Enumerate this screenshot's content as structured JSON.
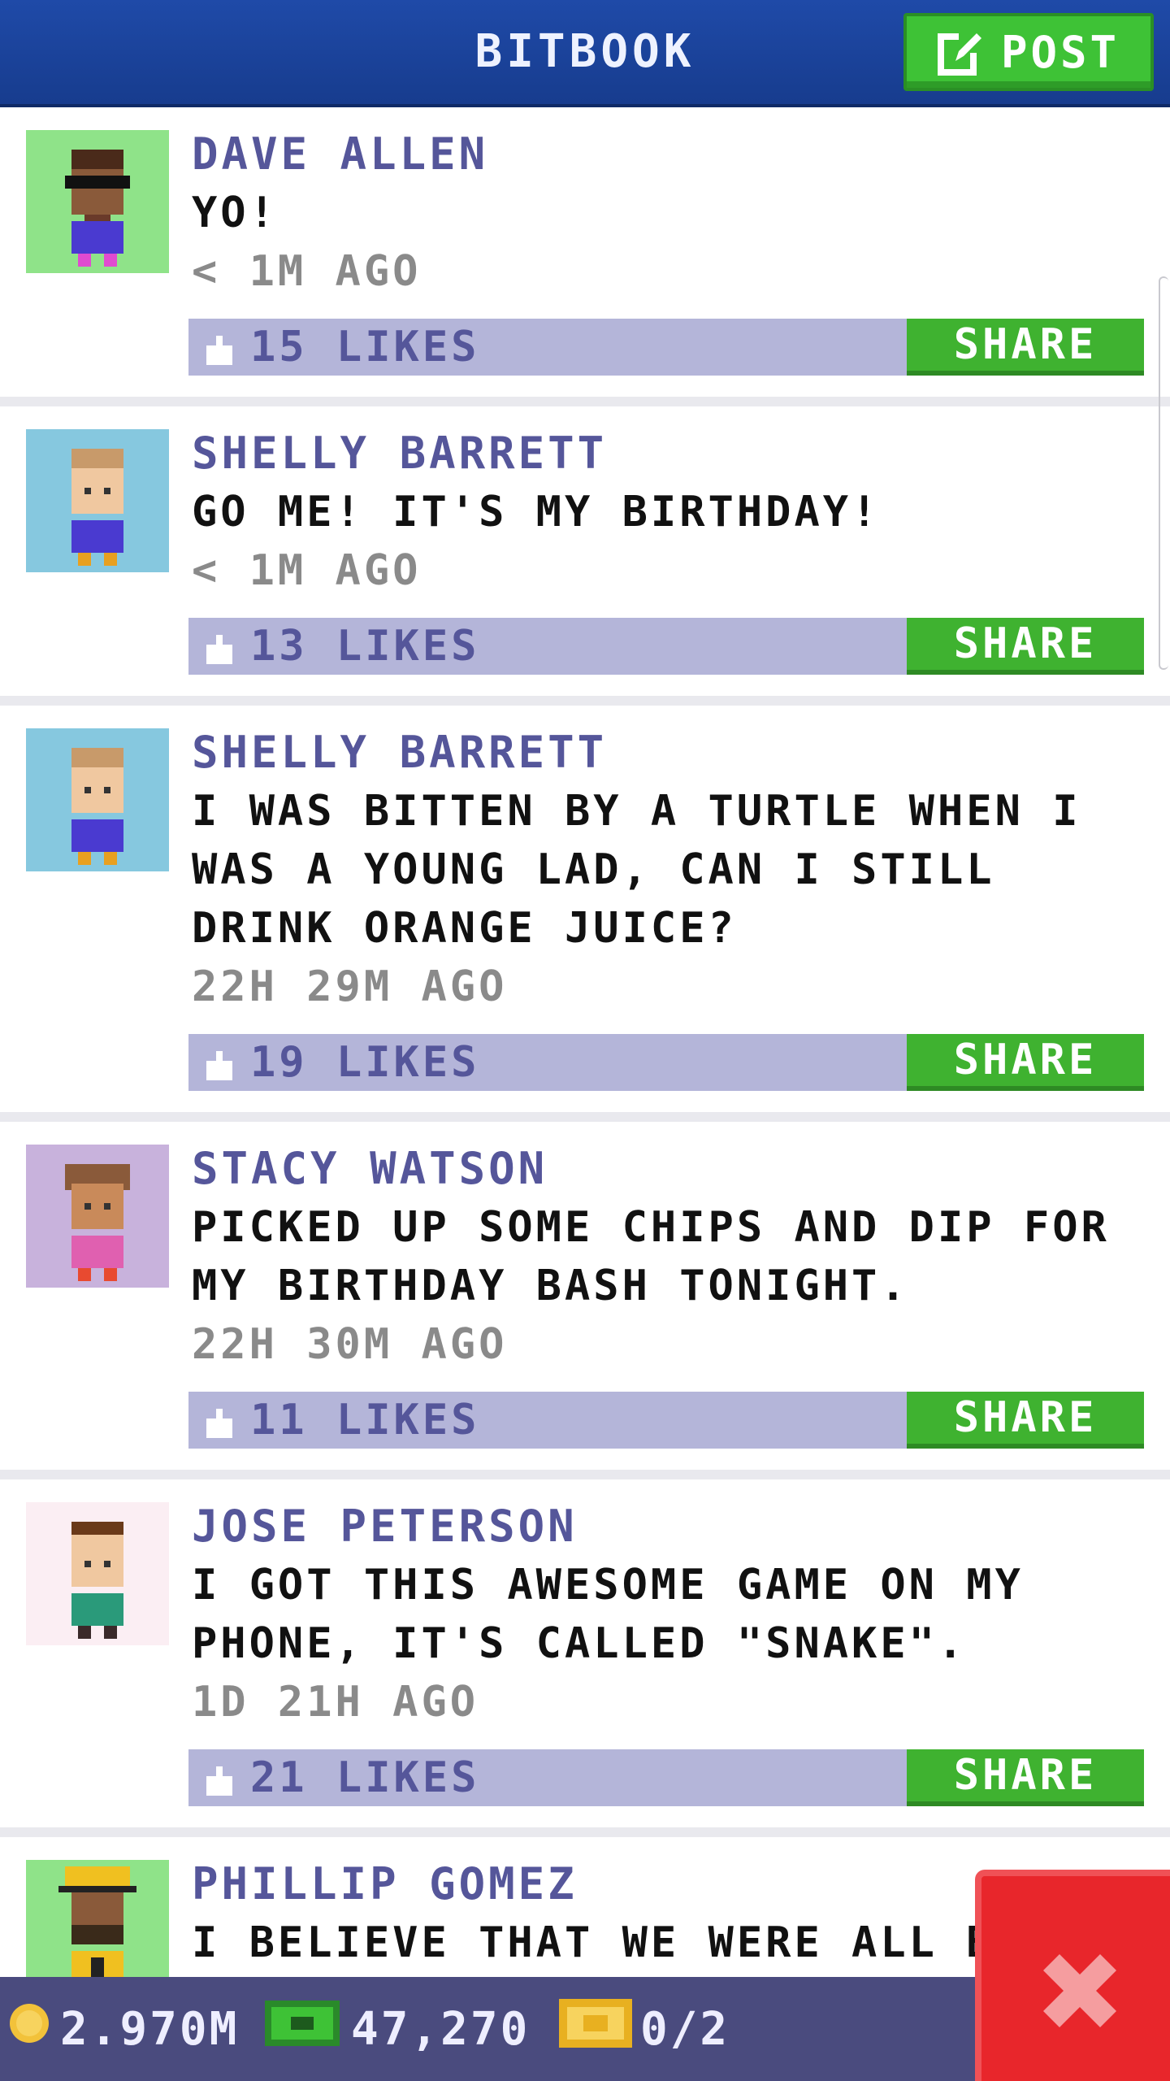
{
  "header": {
    "title": "BITBOOK",
    "post_label": "POST"
  },
  "posts": [
    {
      "author": "DAVE ALLEN",
      "message": "YO!",
      "time": "< 1M AGO",
      "likes": "15 LIKES",
      "share": "SHARE",
      "avatar_bg": "#8fe389"
    },
    {
      "author": "SHELLY BARRETT",
      "message": "GO ME! IT'S MY BIRTHDAY!",
      "time": "< 1M AGO",
      "likes": "13 LIKES",
      "share": "SHARE",
      "avatar_bg": "#86c8df"
    },
    {
      "author": "SHELLY BARRETT",
      "message": "I WAS BITTEN BY A TURTLE WHEN I WAS A YOUNG LAD, CAN I STILL DRINK ORANGE JUICE?",
      "time": "22H 29M AGO",
      "likes": "19 LIKES",
      "share": "SHARE",
      "avatar_bg": "#86c8df"
    },
    {
      "author": "STACY WATSON",
      "message": "PICKED UP SOME CHIPS AND DIP FOR MY BIRTHDAY BASH TONIGHT.",
      "time": "22H 30M AGO",
      "likes": "11 LIKES",
      "share": "SHARE",
      "avatar_bg": "#c8b2dc"
    },
    {
      "author": "JOSE PETERSON",
      "message": "I GOT THIS AWESOME GAME ON MY PHONE, IT'S CALLED \"SNAKE\".",
      "time": "1D 21H AGO",
      "likes": "21 LIKES",
      "share": "SHARE",
      "avatar_bg": "#fbeef3"
    },
    {
      "author": "PHILLIP GOMEZ",
      "message": "I BELIEVE THAT WE WERE ALL BO",
      "time": "",
      "likes": "",
      "share": "",
      "avatar_bg": "#8fe389"
    }
  ],
  "status": {
    "coins": "2.970M",
    "bux": "47,270",
    "tickets": "0/2"
  },
  "colors": {
    "header": "#1f4aa8",
    "post_button": "#3ec236",
    "like_bar": "#b4b5d9",
    "share": "#3fb230",
    "author": "#55569a",
    "close": "#e8262b"
  },
  "icons": {
    "post": "edit-icon",
    "like": "thumb-up-icon",
    "coin": "coin-icon",
    "bux": "bux-icon",
    "ticket": "ticket-icon",
    "close": "close-icon"
  }
}
